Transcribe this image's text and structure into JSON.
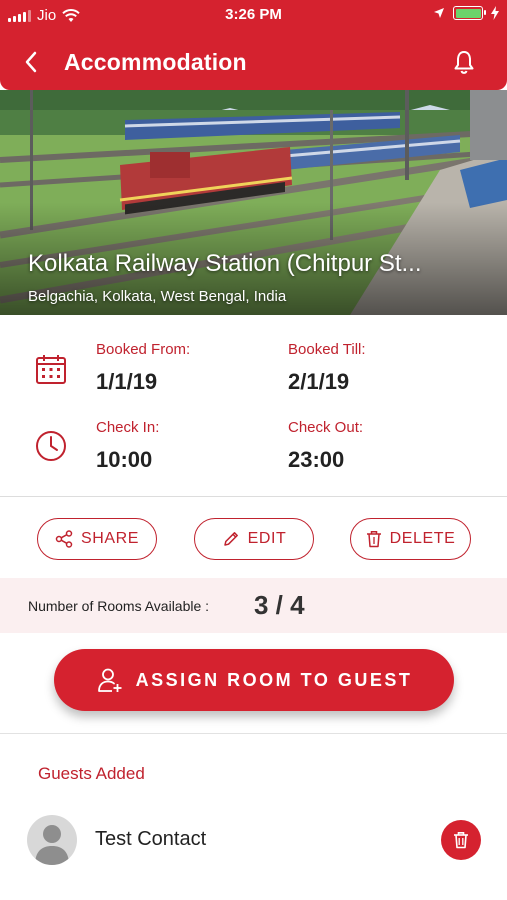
{
  "status_bar": {
    "carrier": "Jio",
    "time": "3:26 PM"
  },
  "header": {
    "title": "Accommodation",
    "back_icon": "chevron-left-icon",
    "notification_icon": "bell-icon"
  },
  "hero": {
    "title": "Kolkata Railway Station (Chitpur St...",
    "subtitle": "Belgachia, Kolkata, West Bengal, India"
  },
  "booking": {
    "booked_from_label": "Booked From:",
    "booked_from_value": "1/1/19",
    "booked_till_label": "Booked Till:",
    "booked_till_value": "2/1/19",
    "check_in_label": "Check In:",
    "check_in_value": "10:00",
    "check_out_label": "Check Out:",
    "check_out_value": "23:00"
  },
  "actions": {
    "share": "SHARE",
    "edit": "EDIT",
    "delete": "DELETE"
  },
  "rooms": {
    "label": "Number of Rooms Available :",
    "value": "3 / 4"
  },
  "assign_button": "ASSIGN ROOM TO GUEST",
  "guests": {
    "title": "Guests Added",
    "items": [
      {
        "name": "Test Contact"
      }
    ]
  },
  "colors": {
    "brand_red": "#d5222f",
    "label_red": "#c0222e",
    "rooms_bg": "#fbeff0"
  }
}
